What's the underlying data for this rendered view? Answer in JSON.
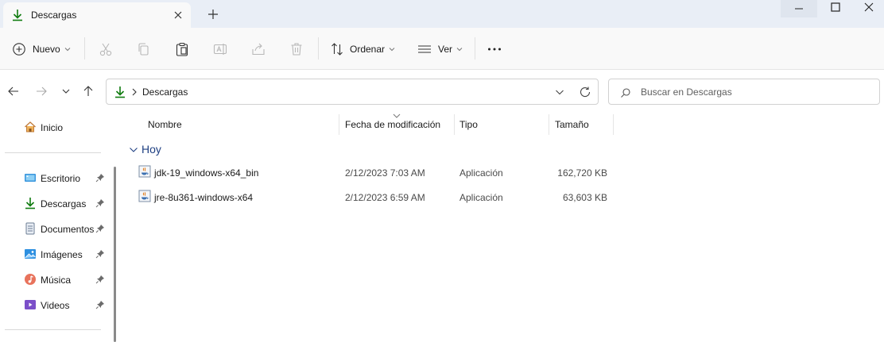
{
  "tab": {
    "title": "Descargas"
  },
  "toolbar": {
    "new_label": "Nuevo",
    "sort_label": "Ordenar",
    "view_label": "Ver",
    "more_label": "···"
  },
  "address": {
    "crumb": "Descargas"
  },
  "search": {
    "placeholder": "Buscar en Descargas"
  },
  "sidebar": {
    "home": "Inicio",
    "items": [
      {
        "label": "Escritorio",
        "icon": "desktop-icon"
      },
      {
        "label": "Descargas",
        "icon": "download-icon"
      },
      {
        "label": "Documentos",
        "icon": "documents-icon"
      },
      {
        "label": "Imágenes",
        "icon": "pictures-icon"
      },
      {
        "label": "Música",
        "icon": "music-icon"
      },
      {
        "label": "Videos",
        "icon": "videos-icon"
      }
    ]
  },
  "columns": {
    "name": "Nombre",
    "date": "Fecha de modificación",
    "type": "Tipo",
    "size": "Tamaño"
  },
  "group": {
    "label": "Hoy"
  },
  "files": [
    {
      "name": "jdk-19_windows-x64_bin",
      "date": "2/12/2023 7:03 AM",
      "type": "Aplicación",
      "size": "162,720 KB"
    },
    {
      "name": "jre-8u361-windows-x64",
      "date": "2/12/2023 6:59 AM",
      "type": "Aplicación",
      "size": "63,603 KB"
    }
  ],
  "colors": {
    "accent": "#0f7b0f",
    "group_text": "#1e3f82",
    "titlebar": "#e9eef6"
  }
}
